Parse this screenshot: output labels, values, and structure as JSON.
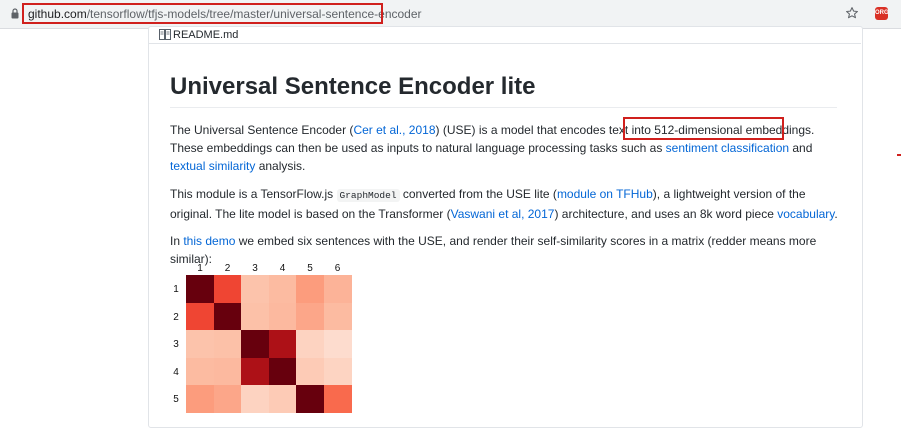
{
  "browser": {
    "url_host": "github.com",
    "url_path": "/tensorflow/tfjs-models/tree/master/universal-sentence-encoder",
    "extension_label": "ORG"
  },
  "readme": {
    "file_name": "README.md",
    "title": "Universal Sentence Encoder lite",
    "p1": {
      "t1": "The Universal Sentence Encoder (",
      "link_cer": "Cer et al., 2018",
      "t2": ") (USE) is a model that encodes text into ",
      "t3": "512-dimensional embeddings.",
      "t4": " These embeddings can then be used as inputs to natural language processing tasks such as ",
      "link_sentiment": "sentiment classification",
      "t5": " and ",
      "link_textual": "textual similarity",
      "t6": " analysis."
    },
    "p2": {
      "t1": "This module is a TensorFlow.js ",
      "code": "GraphModel",
      "t2": " converted from the USE lite (",
      "link_module": "module on TFHub",
      "t3": "), a lightweight version of the original. The lite model is based on the Transformer (",
      "link_vaswani": "Vaswani et al, 2017",
      "t4": ") architecture, and uses an 8k word piece ",
      "link_vocab": "vocabulary",
      "t5": "."
    },
    "p3": {
      "t1": "In ",
      "link_demo": "this demo",
      "t2": " we embed six sentences with the USE, and render their self-similarity scores in a matrix (redder means more similar):"
    }
  },
  "matrix": {
    "col_labels": [
      "1",
      "2",
      "3",
      "4",
      "5",
      "6"
    ],
    "row_labels": [
      "1",
      "2",
      "3",
      "4",
      "5"
    ],
    "cell_colors": [
      [
        "#67000d",
        "#ef4533",
        "#fcc3ab",
        "#fcbba1",
        "#fc9c7d",
        "#fcb398"
      ],
      [
        "#ef4533",
        "#67000d",
        "#fcc1a8",
        "#fcb99f",
        "#fca689",
        "#fcbba1"
      ],
      [
        "#fcc3ab",
        "#fcc1a8",
        "#67000d",
        "#ad1117",
        "#fdd3c1",
        "#fddcce"
      ],
      [
        "#fcbba1",
        "#fcb99f",
        "#ad1117",
        "#67000d",
        "#fdcbb6",
        "#fdd4c2"
      ],
      [
        "#fc9c7d",
        "#fca689",
        "#fdd3c1",
        "#fdcbb6",
        "#67000d",
        "#f96a4d"
      ]
    ]
  },
  "colors": {
    "link": "#0366d6",
    "highlight_box": "#d0201d"
  }
}
